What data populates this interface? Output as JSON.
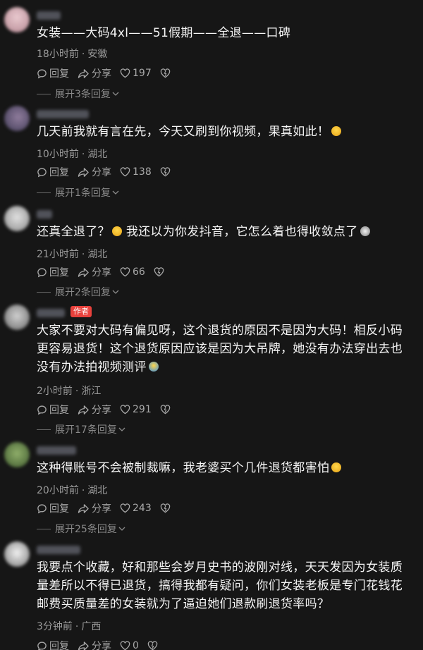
{
  "comments": [
    {
      "text": "女装——大码4xl——51假期——全退——口碑",
      "time": "18小时前",
      "location": "安徽",
      "reply_label": "回复",
      "share_label": "分享",
      "likes": "197",
      "expand": "展开3条回复"
    },
    {
      "text": "几天前我就有言在先，今天又刷到你视频，果真如此！",
      "time": "10小时前",
      "location": "湖北",
      "reply_label": "回复",
      "share_label": "分享",
      "likes": "138",
      "expand": "展开1条回复"
    },
    {
      "text_a": "还真全退了？",
      "text_b": "我还以为你发抖音，它怎么着也得收敛点了",
      "time": "21小时前",
      "location": "湖北",
      "reply_label": "回复",
      "share_label": "分享",
      "likes": "66",
      "expand": "展开2条回复"
    },
    {
      "author_badge": "作者",
      "text": "大家不要对大码有偏见呀，这个退货的原因不是因为大码！相反小码更容易退货！这个退货原因应该是因为大吊牌，她没有办法穿出去也没有办法拍视频测评",
      "time": "2小时前",
      "location": "浙江",
      "reply_label": "回复",
      "share_label": "分享",
      "likes": "291",
      "expand": "展开17条回复"
    },
    {
      "text": "这种得账号不会被制裁嘛，我老婆买个几件退货都害怕",
      "time": "20小时前",
      "location": "湖北",
      "reply_label": "回复",
      "share_label": "分享",
      "likes": "243",
      "expand": "展开25条回复"
    },
    {
      "text": "我要点个收藏，好和那些会岁月史书的波刚对线，天天发因为女装质量差所以不得已退货，搞得我都有疑问，你们女装老板是专门花钱花邮费买质量差的女装就为了逼迫她们退款刷退货率吗？",
      "time": "3分钟前",
      "location": "广西",
      "reply_label": "回复",
      "share_label": "分享",
      "likes": "0"
    }
  ],
  "colors": {
    "background": "#161616",
    "text": "#f5f5f5",
    "meta": "#9a9a9a",
    "author_badge": "#e8413c"
  },
  "icons": [
    "comment-icon",
    "share-icon",
    "heart-icon",
    "dislike-icon",
    "chevron-down-icon"
  ]
}
